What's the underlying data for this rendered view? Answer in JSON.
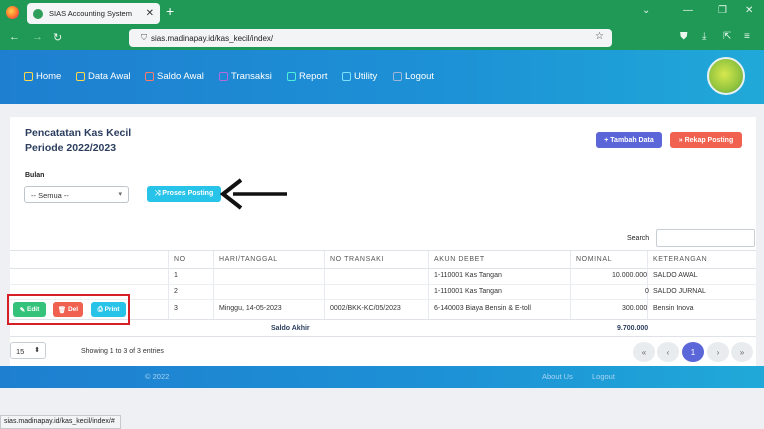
{
  "browser": {
    "tab_title": "SIAS Accounting System",
    "url": "sias.madinapay.id/kas_kecil/index/",
    "status_url": "sias.madinapay.id/kas_kecil/index/#"
  },
  "nav": {
    "items": [
      {
        "label": "Home",
        "icon": "home-icon"
      },
      {
        "label": "Data Awal",
        "icon": "monitor-icon"
      },
      {
        "label": "Saldo Awal",
        "icon": "ledger-icon"
      },
      {
        "label": "Transaksi",
        "icon": "cart-icon"
      },
      {
        "label": "Report",
        "icon": "report-icon"
      },
      {
        "label": "Utility",
        "icon": "tools-icon"
      },
      {
        "label": "Logout",
        "icon": "logout-icon"
      }
    ]
  },
  "page": {
    "title_line1": "Pencatatan Kas Kecil",
    "title_line2": "Periode 2022/2023",
    "tambah_label": "+ Tambah Data",
    "rekap_label": "» Rekap Posting",
    "bulan_label": "Bulan",
    "bulan_value": "-- Semua --",
    "proses_label": "⤨ Proses Posting",
    "search_label": "Search"
  },
  "table": {
    "headers": [
      "NO",
      "HARI/TANGGAL",
      "NO TRANSAKI",
      "AKUN DEBET",
      "NOMINAL",
      "KETERANGAN"
    ],
    "rows": [
      {
        "no": "1",
        "tanggal": "",
        "notrans": "",
        "akun": "1-110001 Kas Tangan",
        "nominal": "10.000.000",
        "ket": "SALDO AWAL"
      },
      {
        "no": "2",
        "tanggal": "",
        "notrans": "",
        "akun": "1-110001 Kas Tangan",
        "nominal": "0",
        "ket": "SALDO JURNAL"
      },
      {
        "no": "3",
        "tanggal": "Minggu, 14-05-2023",
        "notrans": "0002/BKK-KC/05/2023",
        "akun": "6-140003 Biaya Bensin & E-toll",
        "nominal": "300.000",
        "ket": "Bensin Inova"
      }
    ],
    "saldo_label": "Saldo Akhir",
    "saldo_value": "9.700.000"
  },
  "actions": {
    "edit": "Edit",
    "del": "Del",
    "print": "Print"
  },
  "pagination": {
    "per_page": "15",
    "info": "Showing 1 to 3 of 3 entries",
    "current": "1"
  },
  "footer": {
    "copyright": "© 2022",
    "links": [
      "About Us",
      "Logout"
    ]
  },
  "colors": {
    "primary": "#5b67d8",
    "danger": "#f0614f",
    "info": "#27c3e8",
    "success": "#35c27a",
    "nav_green": "#1f9955"
  }
}
